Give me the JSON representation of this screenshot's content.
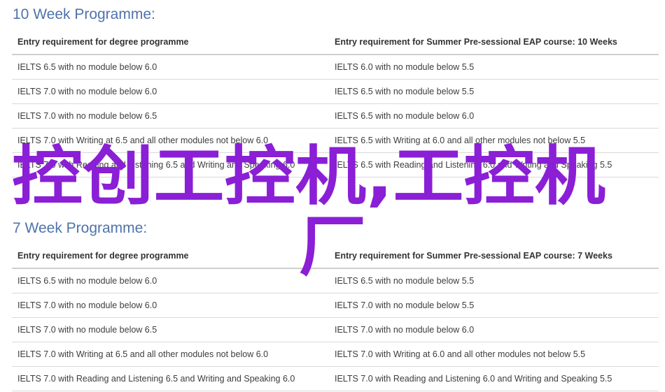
{
  "sections": [
    {
      "title": "10 Week Programme:",
      "headers": [
        "Entry requirement for degree programme",
        "Entry requirement for Summer Pre-sessional EAP course: 10 Weeks"
      ],
      "rows": [
        [
          "IELTS 6.5 with no module below 6.0",
          "IELTS 6.0 with no module below 5.5"
        ],
        [
          "IELTS 7.0 with no module below 6.0",
          "IELTS 6.5 with no module below 5.5"
        ],
        [
          "IELTS 7.0 with no module below 6.5",
          "IELTS 6.5 with no module below 6.0"
        ],
        [
          "IELTS 7.0 with Writing at 6.5 and all other modules not below 6.0",
          "IELTS 6.5 with Writing at 6.0 and all other modules not below 5.5"
        ],
        [
          "IELTS 7.0 with Reading and Listening 6.5 and Writing and Speaking 6.0",
          "IELTS 6.5 with Reading and Listening 6.0 and Writing and Speaking 5.5"
        ]
      ]
    },
    {
      "title": "7 Week Programme:",
      "headers": [
        "Entry requirement for degree programme",
        "Entry requirement for Summer Pre-sessional EAP course: 7 Weeks"
      ],
      "rows": [
        [
          "IELTS 6.5 with no module below 6.0",
          "IELTS 6.5 with no module below 5.5"
        ],
        [
          "IELTS 7.0 with no module below 6.0",
          "IELTS 7.0 with no module below 5.5"
        ],
        [
          "IELTS 7.0 with no module below 6.5",
          "IELTS 7.0 with no module below 6.0"
        ],
        [
          "IELTS 7.0 with Writing at 6.5 and all other modules not below 6.0",
          "IELTS 7.0 with Writing at 6.0 and all other modules not below 5.5"
        ],
        [
          "IELTS 7.0 with Reading and Listening 6.5 and Writing and Speaking 6.0",
          "IELTS 7.0 with Reading and Listening 6.0 and Writing and Speaking 5.5"
        ]
      ]
    }
  ],
  "watermark": {
    "line1": "控创工控机,工控机",
    "line2": "厂",
    "color": "#8a1fd6"
  },
  "colors": {
    "title": "#4f73a9",
    "text": "#3d3d3d",
    "rule": "#d9d9d9"
  }
}
